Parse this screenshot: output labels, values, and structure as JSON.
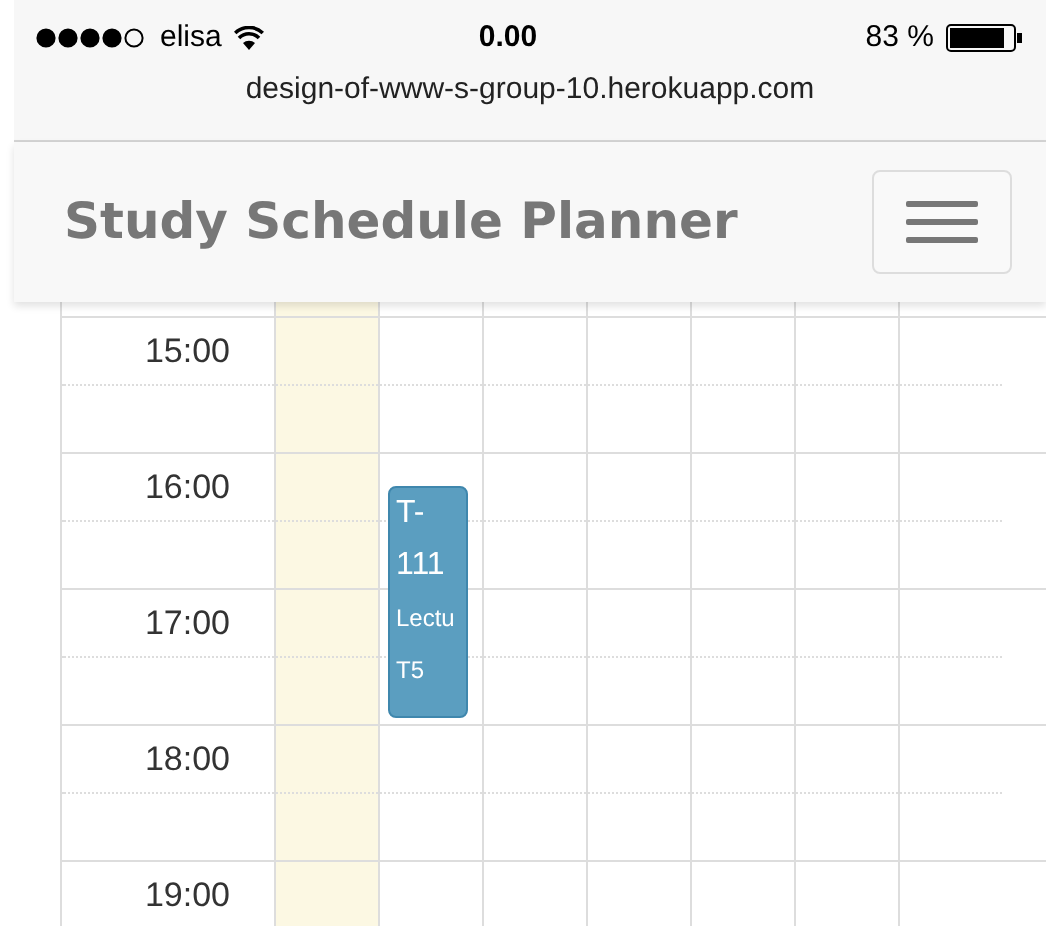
{
  "status_bar": {
    "carrier": "elisa",
    "time": "0.00",
    "battery": "83 %"
  },
  "address_bar": {
    "url": "design-of-www-s-group-10.herokuapp.com"
  },
  "navbar": {
    "title": "Study Schedule Planner"
  },
  "days": [
    {
      "today": true
    },
    {
      "today": false
    },
    {
      "today": false
    },
    {
      "today": false
    },
    {
      "today": false
    },
    {
      "today": false
    },
    {
      "today": false
    }
  ],
  "hours": [
    {
      "label": "15:00"
    },
    {
      "label": "16:00"
    },
    {
      "label": "17:00"
    },
    {
      "label": "18:00"
    },
    {
      "label": "19:00"
    }
  ],
  "events": [
    {
      "lines": [
        "T-",
        "111",
        "Lectu",
        "T5"
      ]
    }
  ]
}
